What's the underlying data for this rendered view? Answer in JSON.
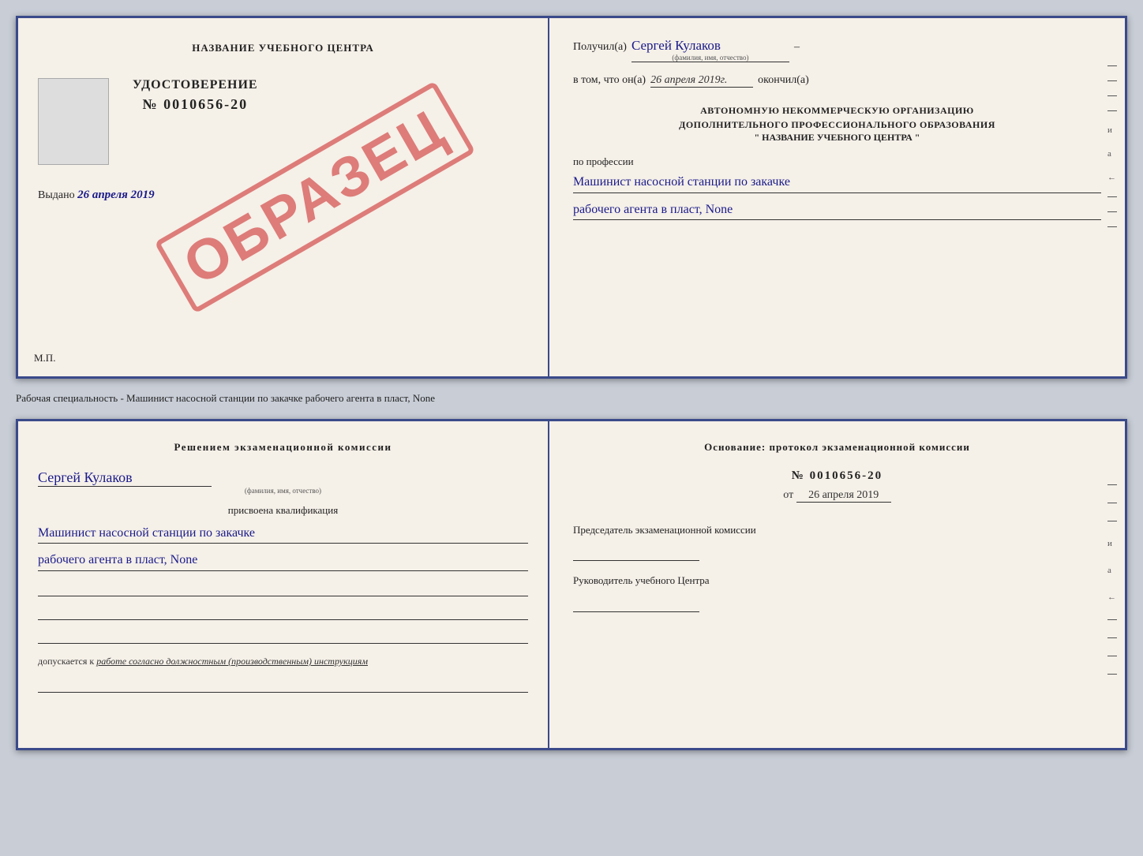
{
  "top_left": {
    "title": "НАЗВАНИЕ УЧЕБНОГО ЦЕНТРА",
    "cert_label": "УДОСТОВЕРЕНИЕ",
    "cert_number": "№ 0010656-20",
    "vydano_prefix": "Выдано",
    "vydano_date": "26 апреля 2019",
    "mp_label": "М.П.",
    "obrazets": "ОБРАЗЕЦ"
  },
  "top_right": {
    "poluchil_prefix": "Получил(а)",
    "receiver_name": "Сергей Кулаков",
    "fio_hint": "(фамилия, имя, отчество)",
    "vtom_prefix": "в том, что он(а)",
    "date_value": "26 апреля 2019г.",
    "okonchil": "окончил(а)",
    "org_line1": "АВТОНОМНУЮ НЕКОММЕРЧЕСКУЮ ОРГАНИЗАЦИЮ",
    "org_line2": "ДОПОЛНИТЕЛЬНОГО ПРОФЕССИОНАЛЬНОГО ОБРАЗОВАНИЯ",
    "org_name": "\"  НАЗВАНИЕ УЧЕБНОГО ЦЕНТРА  \"",
    "po_professii": "по профессии",
    "profession_line1": "Машинист насосной станции по закачке",
    "profession_line2": "рабочего агента в пласт, None"
  },
  "middle_text": "Рабочая специальность - Машинист насосной станции по закачке рабочего агента в пласт,\nNone",
  "bottom_left": {
    "decision_title": "Решением экзаменационной комиссии",
    "person_name": "Сергей Кулаков",
    "fio_hint": "(фамилия, имя, отчество)",
    "prisvоena_label": "присвоена квалификация",
    "qualification_line1": "Машинист насосной станции по закачке",
    "qualification_line2": "рабочего агента в пласт, None",
    "dopuskaetsya_prefix": "допускается к",
    "dopuskaetsya_italic": "работе согласно должностным (производственным) инструкциям"
  },
  "bottom_right": {
    "osnование_label": "Основание: протокол экзаменационной комиссии",
    "protocol_number": "№ 0010656-20",
    "ot_prefix": "от",
    "protocol_date": "26 апреля 2019",
    "predsedatel_label": "Председатель экзаменационной комиссии",
    "rukovoditel_label": "Руководитель учебного Центра"
  },
  "dashes": [
    "-",
    "-",
    "-",
    "и",
    "а",
    "←",
    "-",
    "-",
    "-",
    "-"
  ]
}
